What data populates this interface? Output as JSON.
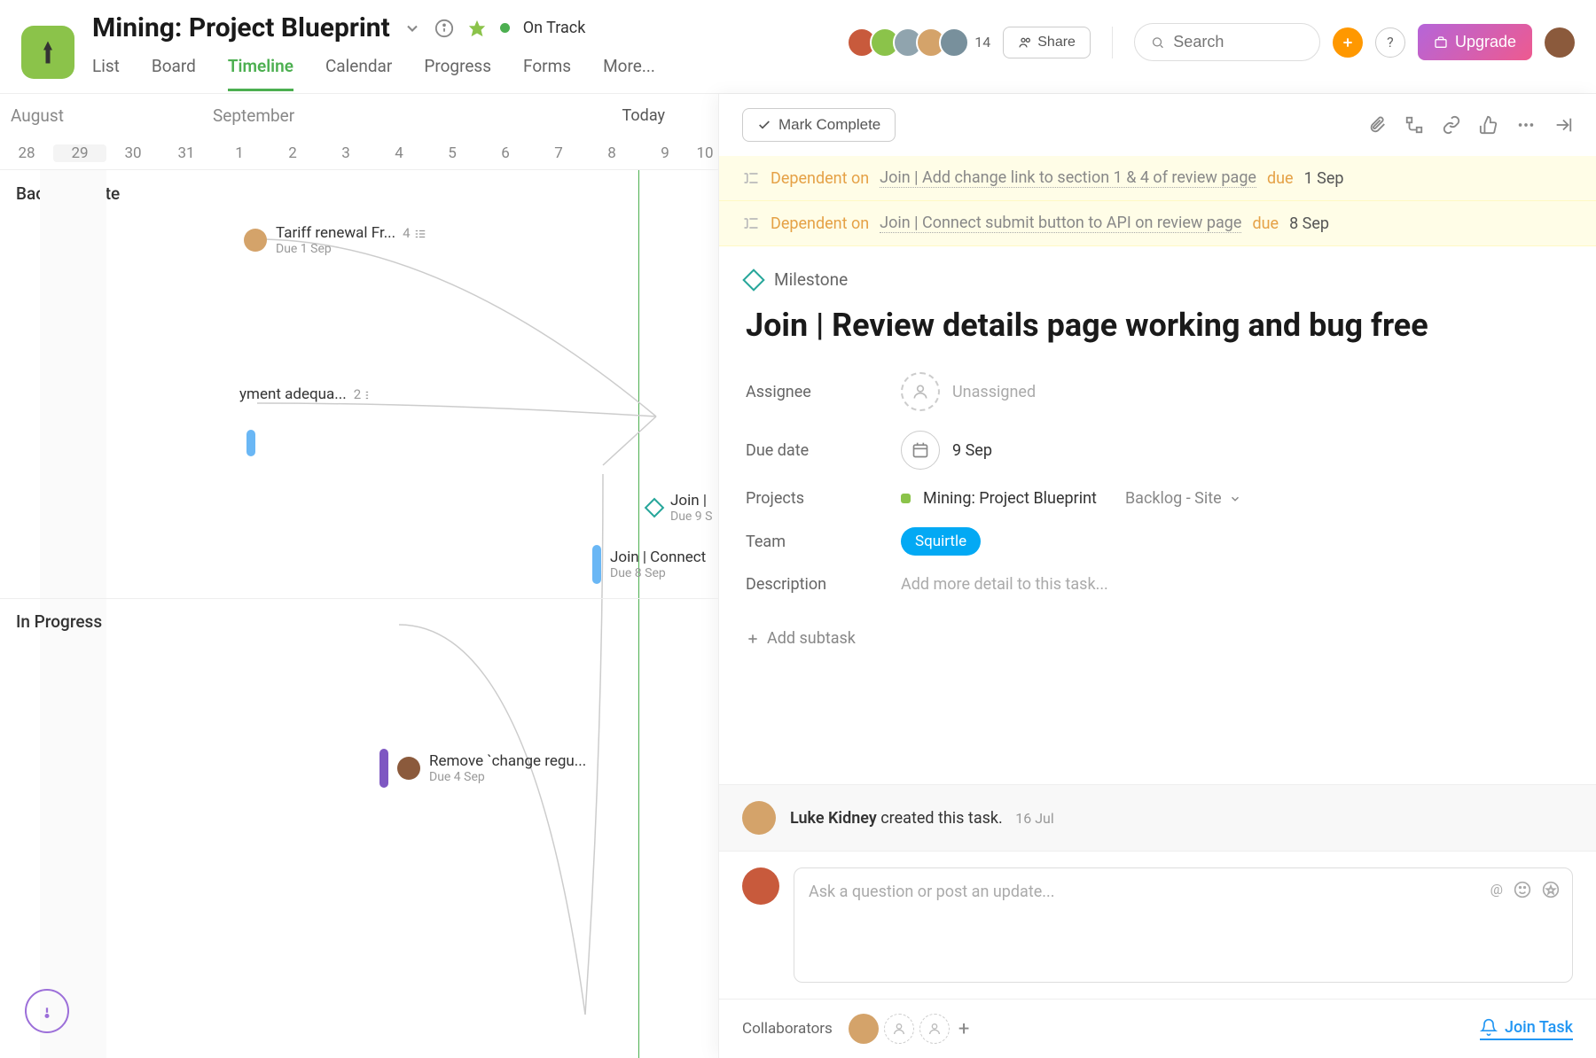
{
  "header": {
    "title": "Mining: Project Blueprint",
    "status": "On Track",
    "avatar_count": "14",
    "share": "Share",
    "search_placeholder": "Search",
    "upgrade": "Upgrade",
    "tabs": [
      "List",
      "Board",
      "Timeline",
      "Calendar",
      "Progress",
      "Forms",
      "More..."
    ],
    "active_tab": "Timeline"
  },
  "timeline": {
    "months": {
      "aug": "August",
      "sep": "September"
    },
    "today": "Today",
    "days": [
      "28",
      "29",
      "30",
      "31",
      "1",
      "2",
      "3",
      "4",
      "5",
      "6",
      "7",
      "8",
      "9",
      "10"
    ],
    "sections": {
      "backlog": "Backlog - Site",
      "in_progress": "In Progress"
    },
    "tasks": {
      "tariff": {
        "title": "Tariff renewal Fr...",
        "due": "Due 1 Sep",
        "count": "4"
      },
      "payment": {
        "title": "yment adequa...",
        "count": "2"
      },
      "join_milestone": {
        "title": "Join |",
        "due": "Due 9 S"
      },
      "connect": {
        "title": "Join | Connect",
        "due": "Due 8 Sep"
      },
      "remove": {
        "title": "Remove `change regu...",
        "due": "Due 4 Sep"
      }
    }
  },
  "detail": {
    "mark_complete": "Mark Complete",
    "deps": [
      {
        "label": "Dependent on",
        "link": "Join | Add change link to section 1 & 4 of review page",
        "due_word": "due",
        "date": "1 Sep"
      },
      {
        "label": "Dependent on",
        "link": "Join | Connect submit button to API on review page",
        "due_word": "due",
        "date": "8 Sep"
      }
    ],
    "milestone_label": "Milestone",
    "title": "Join | Review details page working and bug free",
    "fields": {
      "assignee": {
        "label": "Assignee",
        "value": "Unassigned"
      },
      "due": {
        "label": "Due date",
        "value": "9 Sep"
      },
      "projects": {
        "label": "Projects",
        "value": "Mining: Project Blueprint",
        "section": "Backlog - Site"
      },
      "team": {
        "label": "Team",
        "value": "Squirtle"
      },
      "description": {
        "label": "Description",
        "placeholder": "Add more detail to this task..."
      }
    },
    "add_subtask": "Add subtask",
    "activity": {
      "author": "Luke Kidney",
      "action": " created this task.",
      "date": "16 Jul"
    },
    "comment_placeholder": "Ask a question or post an update...",
    "collaborators_label": "Collaborators",
    "join_task": "Join Task"
  }
}
